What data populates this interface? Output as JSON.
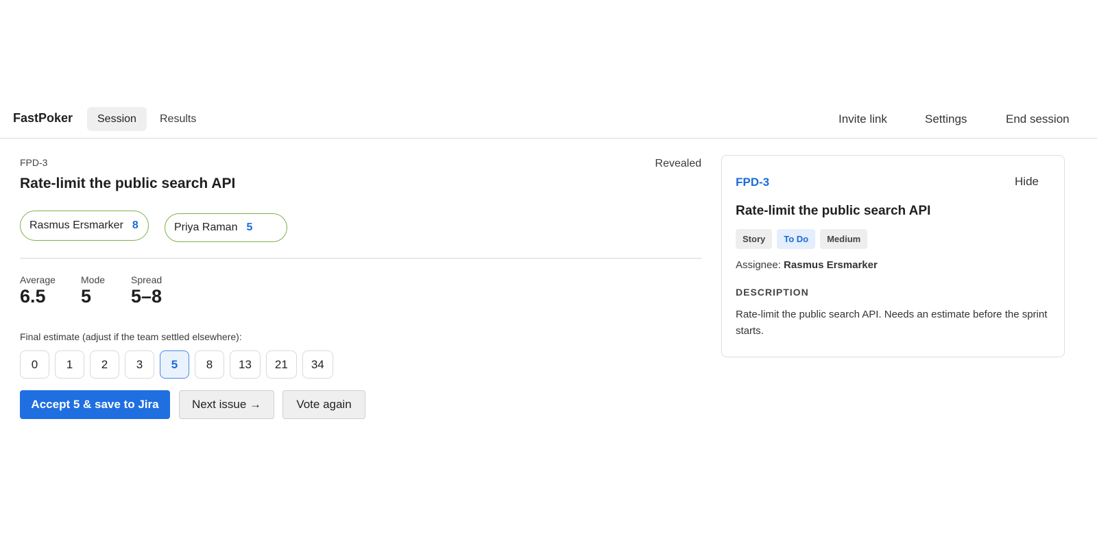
{
  "app": {
    "brand": "FastPoker"
  },
  "nav": {
    "tabs": [
      {
        "label": "Session",
        "active": true
      },
      {
        "label": "Results",
        "active": false
      }
    ],
    "actions": {
      "invite": "Invite link",
      "settings": "Settings",
      "end": "End session"
    }
  },
  "issue": {
    "key": "FPD-3",
    "title": "Rate-limit the public search API",
    "status": "Revealed"
  },
  "voters": [
    {
      "name": "Rasmus Ersmarker",
      "vote": "8"
    },
    {
      "name": "Priya Raman",
      "vote": "5"
    }
  ],
  "stats": {
    "average_label": "Average",
    "average_value": "6.5",
    "mode_label": "Mode",
    "mode_value": "5",
    "spread_label": "Spread",
    "spread_value": "5–8"
  },
  "final": {
    "label": "Final estimate (adjust if the team settled elsewhere):",
    "cards": [
      "0",
      "1",
      "2",
      "3",
      "5",
      "8",
      "13",
      "21",
      "34"
    ],
    "selected": "5"
  },
  "buttons": {
    "accept": "Accept 5 & save to Jira",
    "next": "Next issue →",
    "vote_again": "Vote again"
  },
  "panel": {
    "key": "FPD-3",
    "hide": "Hide",
    "title": "Rate-limit the public search API",
    "tags": [
      "Story",
      "To Do",
      "Medium"
    ],
    "assignee_label": "Assignee:",
    "assignee": "Rasmus Ersmarker",
    "description_heading": "DESCRIPTION",
    "description": "Rate-limit the public search API. Needs an estimate before the sprint starts."
  },
  "colors": {
    "accent": "#1f6fe0",
    "voter_border": "#7fb04a",
    "link": "#1a6bd8"
  }
}
